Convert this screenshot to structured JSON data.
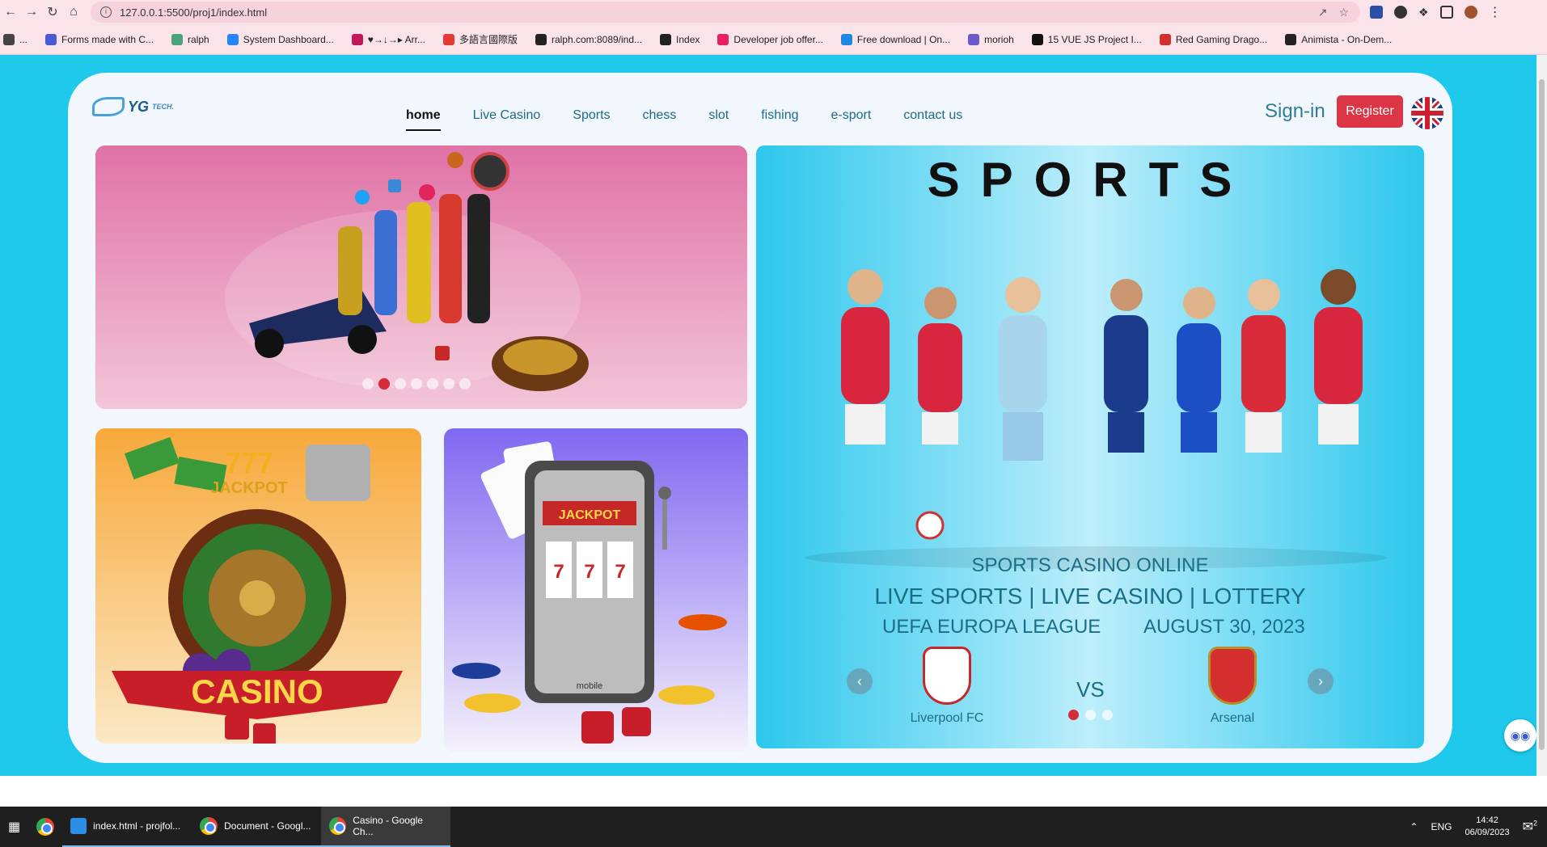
{
  "browser": {
    "url": "127.0.0.1:5500/proj1/index.html",
    "bookmarks": [
      {
        "label": "...",
        "color": "#444444"
      },
      {
        "label": "Forms made with C...",
        "color": "#4b5bd6"
      },
      {
        "label": "ralph",
        "color": "#4aa37a"
      },
      {
        "label": "System Dashboard...",
        "color": "#2684ff"
      },
      {
        "label": "♥→↓→▸ Arr...",
        "color": "#c2185b"
      },
      {
        "label": "多語言國際版",
        "color": "#e53935"
      },
      {
        "label": "ralph.com:8089/ind...",
        "color": "#222222"
      },
      {
        "label": "Index",
        "color": "#222222"
      },
      {
        "label": "Developer job offer...",
        "color": "#e91e63"
      },
      {
        "label": "Free download | On...",
        "color": "#1e88e5"
      },
      {
        "label": "morioh",
        "color": "#6a5acd"
      },
      {
        "label": "15 VUE JS Project I...",
        "color": "#111111"
      },
      {
        "label": "Red Gaming Drago...",
        "color": "#d32f2f"
      },
      {
        "label": "Animista - On-Dem...",
        "color": "#222222"
      }
    ]
  },
  "site": {
    "logo_text": "YG",
    "logo_small": "TECH.",
    "nav": [
      "home",
      "Live Casino",
      "Sports",
      "chess",
      "slot",
      "fishing",
      "e-sport",
      "contact us"
    ],
    "signin": "Sign-in",
    "register": "Register",
    "carousel_dots": 7,
    "carousel_active": 1
  },
  "sports": {
    "title": "SPORTS",
    "line1": "SPORTS CASINO ONLINE",
    "line2": "LIVE SPORTS | LIVE CASINO | LOTTERY",
    "league": "UEFA EUROPA LEAGUE",
    "date": "AUGUST 30, 2023",
    "home_team": "Liverpool FC",
    "away_team": "Arsenal",
    "vs": "VS",
    "slide_dots": 3,
    "slide_active": 0,
    "prev": "‹",
    "next": "›"
  },
  "tiles": {
    "casino_label": "CASINO",
    "jackpot_label": "JACKPOT",
    "sevens": "777",
    "slot_label": "JACKPOT",
    "mobile_label": "mobile"
  },
  "taskbar": {
    "apps": [
      {
        "label": "index.html - projfol...",
        "icon": "vscode-icon"
      },
      {
        "label": "Document - Googl...",
        "icon": "chrome-icon"
      },
      {
        "label": "Casino - Google Ch...",
        "icon": "chrome-icon"
      }
    ],
    "lang": "ENG",
    "time": "14:42",
    "date": "06/09/2023",
    "notif_count": "2"
  },
  "colors": {
    "page_bg": "#1ec9ec",
    "accent_red": "#dc3545",
    "nav_text": "#1b6c86"
  }
}
